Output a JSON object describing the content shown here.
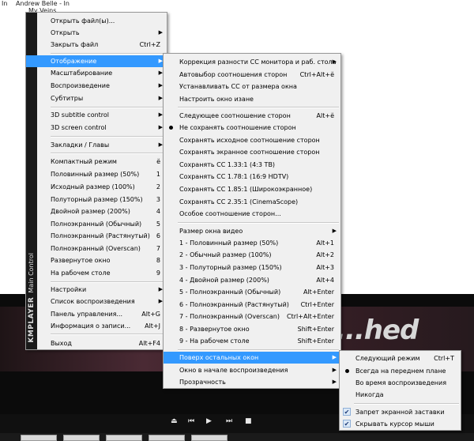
{
  "background": {
    "frag_left": "In",
    "frag_user": "Andrew Belle - In",
    "frag_sub": "My Veins",
    "slogan": "...hed"
  },
  "player": {
    "brand": "KMPLAYER",
    "side_label": "Main Control",
    "controls": [
      "⏏",
      "⏮",
      "▶",
      "⏭",
      "■"
    ]
  },
  "main_menu": [
    {
      "label": "Открыть файл(ы)...",
      "shortcut": "",
      "arrow": false
    },
    {
      "label": "Открыть",
      "shortcut": "",
      "arrow": true
    },
    {
      "label": "Закрыть файл",
      "shortcut": "Ctrl+Z",
      "arrow": false
    },
    {
      "label": "Отображение",
      "shortcut": "",
      "arrow": true,
      "highlight": true
    },
    {
      "label": "Масштабирование",
      "shortcut": "",
      "arrow": true
    },
    {
      "label": "Воспроизведение",
      "shortcut": "",
      "arrow": true
    },
    {
      "label": "Субтитры",
      "shortcut": "",
      "arrow": true
    },
    {
      "label": "3D subtitle control",
      "shortcut": "",
      "arrow": true
    },
    {
      "label": "3D screen control",
      "shortcut": "",
      "arrow": true
    },
    {
      "label": "Закладки / Главы",
      "shortcut": "",
      "arrow": true
    },
    {
      "label": "Компактный режим",
      "shortcut": "ё",
      "arrow": false
    },
    {
      "label": "Половинный размер (50%)",
      "shortcut": "1",
      "arrow": false
    },
    {
      "label": "Исходный размер (100%)",
      "shortcut": "2",
      "arrow": false
    },
    {
      "label": "Полуторный размер (150%)",
      "shortcut": "3",
      "arrow": false
    },
    {
      "label": "Двойной размер (200%)",
      "shortcut": "4",
      "arrow": false
    },
    {
      "label": "Полноэкранный (Обычный)",
      "shortcut": "5",
      "arrow": false
    },
    {
      "label": "Полноэкранный (Растянутый)",
      "shortcut": "6",
      "arrow": false
    },
    {
      "label": "Полноэкранный (Overscan)",
      "shortcut": "7",
      "arrow": false
    },
    {
      "label": "Развернутое окно",
      "shortcut": "8",
      "arrow": false
    },
    {
      "label": "На рабочем столе",
      "shortcut": "9",
      "arrow": false
    },
    {
      "label": "Настройки",
      "shortcut": "",
      "arrow": true
    },
    {
      "label": "Список воспроизведения",
      "shortcut": "",
      "arrow": true
    },
    {
      "label": "Панель управления...",
      "shortcut": "Alt+G",
      "arrow": false
    },
    {
      "label": "Информация о записи...",
      "shortcut": "Alt+J",
      "arrow": false
    },
    {
      "label": "Выход",
      "shortcut": "Alt+F4",
      "arrow": false
    }
  ],
  "sub_menu": [
    {
      "label": "Коррекция разности СС монитора и раб. стола",
      "shortcut": "",
      "arrow": true
    },
    {
      "label": "Автовыбор соотношения сторон",
      "shortcut": "Ctrl+Alt+ё",
      "arrow": false
    },
    {
      "label": "Устанавливать СС от размера окна",
      "shortcut": "",
      "arrow": false
    },
    {
      "label": "Настроить окно изане",
      "shortcut": "",
      "arrow": false
    },
    {
      "label": "Следующее соотношение сторон",
      "shortcut": "Alt+ё",
      "arrow": false
    },
    {
      "label": "Не сохранять соотношение сторон",
      "shortcut": "",
      "arrow": false,
      "bullet": true
    },
    {
      "label": "Сохранять исходное соотношение сторон",
      "shortcut": "",
      "arrow": false
    },
    {
      "label": "Сохранять экранное соотношение сторон",
      "shortcut": "",
      "arrow": false
    },
    {
      "label": "Сохранять СС 1.33:1 (4:3 ТВ)",
      "shortcut": "",
      "arrow": false
    },
    {
      "label": "Сохранять СС 1.78:1 (16:9 HDTV)",
      "shortcut": "",
      "arrow": false
    },
    {
      "label": "Сохранять СС 1.85:1 (Широкоэкранное)",
      "shortcut": "",
      "arrow": false
    },
    {
      "label": "Сохранять СС 2.35:1 (CinemaScope)",
      "shortcut": "",
      "arrow": false
    },
    {
      "label": "Особое соотношение сторон...",
      "shortcut": "",
      "arrow": false
    },
    {
      "label": "Размер окна видео",
      "shortcut": "",
      "arrow": true
    },
    {
      "label": "1 - Половинный размер (50%)",
      "shortcut": "Alt+1",
      "arrow": false
    },
    {
      "label": "2 - Обычный размер (100%)",
      "shortcut": "Alt+2",
      "arrow": false
    },
    {
      "label": "3 - Полуторный размер (150%)",
      "shortcut": "Alt+3",
      "arrow": false
    },
    {
      "label": "4 - Двойной размер (200%)",
      "shortcut": "Alt+4",
      "arrow": false
    },
    {
      "label": "5 - Полноэкранный (Обычный)",
      "shortcut": "Alt+Enter",
      "arrow": false
    },
    {
      "label": "6 - Полноэкранный (Растянутый)",
      "shortcut": "Ctrl+Enter",
      "arrow": false
    },
    {
      "label": "7 - Полноэкранный (Overscan)",
      "shortcut": "Ctrl+Alt+Enter",
      "arrow": false
    },
    {
      "label": "8 - Развернутое окно",
      "shortcut": "Shift+Enter",
      "arrow": false
    },
    {
      "label": "9 - На рабочем столе",
      "shortcut": "Shift+Enter",
      "arrow": false
    },
    {
      "label": "Поверх остальных окон",
      "shortcut": "",
      "arrow": true,
      "highlight": true
    },
    {
      "label": "Окно в начале воспроизведения",
      "shortcut": "",
      "arrow": true
    },
    {
      "label": "Прозрачность",
      "shortcut": "",
      "arrow": true
    }
  ],
  "ontop_menu": [
    {
      "label": "Следующий режим",
      "shortcut": "Ctrl+T"
    },
    {
      "label": "Всегда на переднем плане",
      "shortcut": "",
      "bullet": true
    },
    {
      "label": "Во время воспроизведения",
      "shortcut": ""
    },
    {
      "label": "Никогда",
      "shortcut": ""
    },
    {
      "label": "Запрет экранной заставки",
      "shortcut": "",
      "checked": true
    },
    {
      "label": "Скрывать курсор мыши",
      "shortcut": "",
      "checked": true
    }
  ],
  "colors": {
    "highlight": "#3399ff",
    "menu_bg": "#f0f0f0"
  }
}
